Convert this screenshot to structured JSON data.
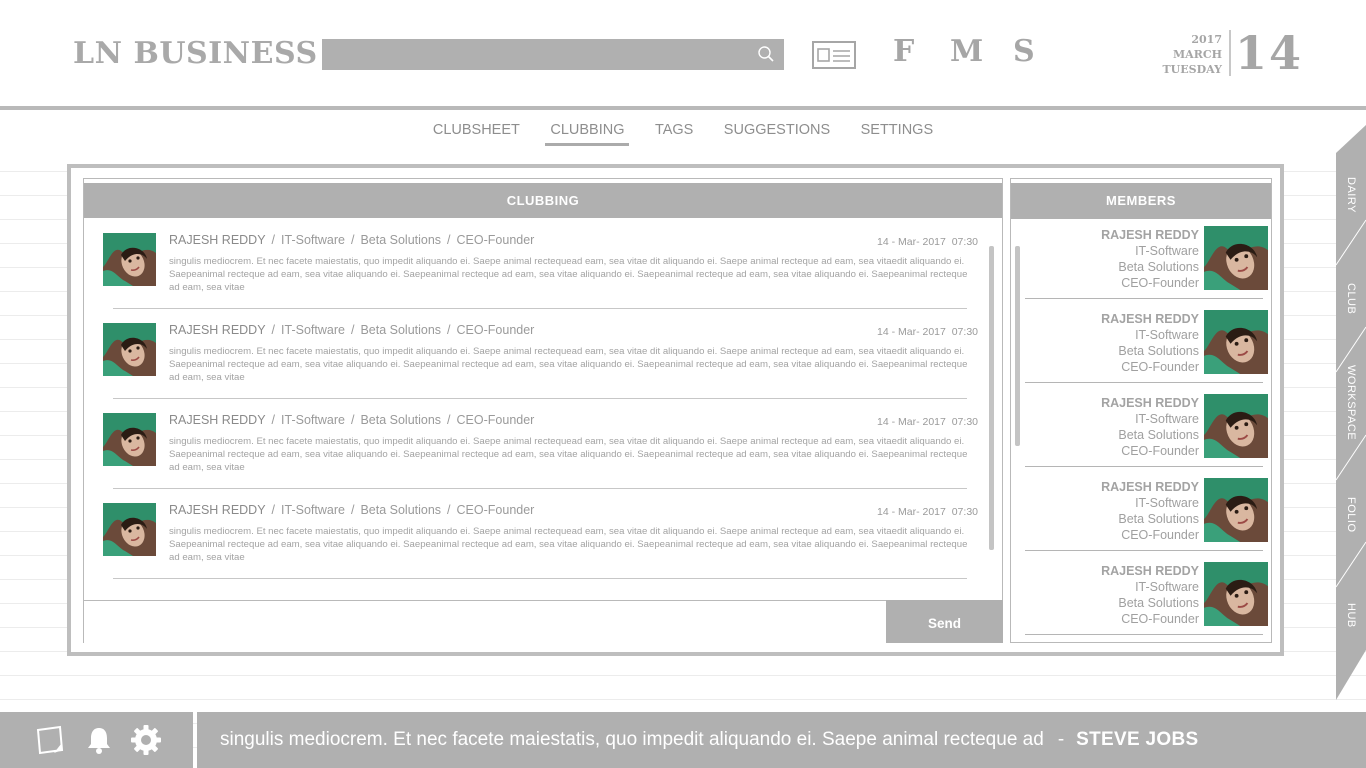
{
  "header": {
    "logo": "LN BUSINESS",
    "search_placeholder": "",
    "letters": [
      "F",
      "M",
      "S"
    ],
    "date": {
      "year": "2017",
      "month": "MARCH",
      "weekday": "TUESDAY",
      "day": "14"
    }
  },
  "nav": {
    "items": [
      "CLUBSHEET",
      "CLUBBING",
      "TAGS",
      "SUGGESTIONS",
      "SETTINGS"
    ],
    "active": "CLUBBING"
  },
  "chat": {
    "title": "CLUBBING",
    "messages": [
      {
        "name": "RAJESH REDDY",
        "industry": "IT-Software",
        "company": "Beta Solutions",
        "role": "CEO-Founder",
        "date": "14 - Mar- 2017",
        "time": "07:30",
        "text": "singulis mediocrem. Et nec facete maiestatis, quo impedit aliquando ei. Saepe animal rectequead eam, sea vitae dit aliquando ei. Saepe animal recteque ad eam, sea vitaedit aliquando ei. Saepeanimal recteque ad eam, sea vitae aliquando ei. Saepeanimal recteque ad eam, sea vitae aliquando ei. Saepeanimal recteque ad eam, sea vitae aliquando ei. Saepeanimal recteque ad eam, sea vitae"
      },
      {
        "name": "RAJESH REDDY",
        "industry": "IT-Software",
        "company": "Beta Solutions",
        "role": "CEO-Founder",
        "date": "14 - Mar- 2017",
        "time": "07:30",
        "text": "singulis mediocrem. Et nec facete maiestatis, quo impedit aliquando ei. Saepe animal rectequead eam, sea vitae dit aliquando ei. Saepe animal recteque ad eam, sea vitaedit aliquando ei. Saepeanimal recteque ad eam, sea vitae aliquando ei. Saepeanimal recteque ad eam, sea vitae aliquando ei. Saepeanimal recteque ad eam, sea vitae aliquando ei. Saepeanimal recteque ad eam, sea vitae"
      },
      {
        "name": "RAJESH REDDY",
        "industry": "IT-Software",
        "company": "Beta Solutions",
        "role": "CEO-Founder",
        "date": "14 - Mar- 2017",
        "time": "07:30",
        "text": "singulis mediocrem. Et nec facete maiestatis, quo impedit aliquando ei. Saepe animal rectequead eam, sea vitae dit aliquando ei. Saepe animal recteque ad eam, sea vitaedit aliquando ei. Saepeanimal recteque ad eam, sea vitae aliquando ei. Saepeanimal recteque ad eam, sea vitae aliquando ei. Saepeanimal recteque ad eam, sea vitae aliquando ei. Saepeanimal recteque ad eam, sea vitae"
      },
      {
        "name": "RAJESH REDDY",
        "industry": "IT-Software",
        "company": "Beta Solutions",
        "role": "CEO-Founder",
        "date": "14 - Mar- 2017",
        "time": "07:30",
        "text": "singulis mediocrem. Et nec facete maiestatis, quo impedit aliquando ei. Saepe animal rectequead eam, sea vitae dit aliquando ei. Saepe animal recteque ad eam, sea vitaedit aliquando ei. Saepeanimal recteque ad eam, sea vitae aliquando ei. Saepeanimal recteque ad eam, sea vitae aliquando ei. Saepeanimal recteque ad eam, sea vitae aliquando ei. Saepeanimal recteque ad eam, sea vitae"
      }
    ],
    "composer_placeholder": "",
    "send_label": "Send"
  },
  "members": {
    "title": "MEMBERS",
    "list": [
      {
        "name": "RAJESH REDDY",
        "industry": "IT-Software",
        "company": "Beta Solutions",
        "role": "CEO-Founder"
      },
      {
        "name": "RAJESH REDDY",
        "industry": "IT-Software",
        "company": "Beta Solutions",
        "role": "CEO-Founder"
      },
      {
        "name": "RAJESH REDDY",
        "industry": "IT-Software",
        "company": "Beta Solutions",
        "role": "CEO-Founder"
      },
      {
        "name": "RAJESH REDDY",
        "industry": "IT-Software",
        "company": "Beta Solutions",
        "role": "CEO-Founder"
      },
      {
        "name": "RAJESH REDDY",
        "industry": "IT-Software",
        "company": "Beta Solutions",
        "role": "CEO-Founder"
      }
    ]
  },
  "side_tabs": [
    "DAIRY",
    "CLUB",
    "WORKSPACE",
    "FOLIO",
    "HUB"
  ],
  "footer": {
    "quote": "singulis mediocrem. Et nec facete maiestatis, quo impedit aliquando ei. Saepe animal recteque ad",
    "separator": "-",
    "author": "STEVE JOBS",
    "icons": [
      "notes-icon",
      "bell-icon",
      "gear-icon"
    ]
  },
  "colors": {
    "panel_gray": "#b0b0b0",
    "text_gray": "#9a9a9a",
    "frame_gray": "#bebebe",
    "avatar_green": "#2f8f6a"
  }
}
